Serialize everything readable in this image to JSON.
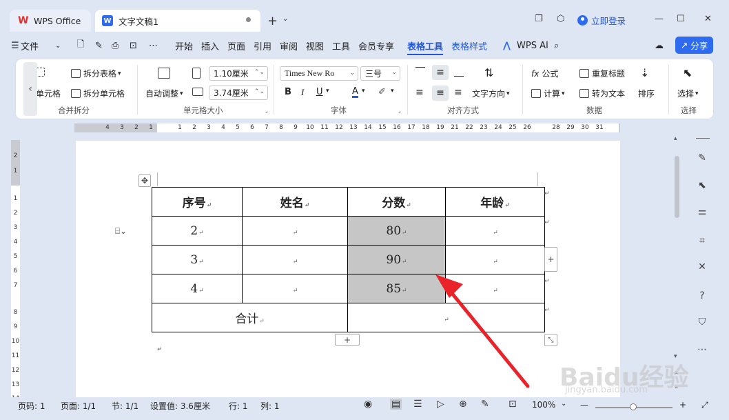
{
  "tabs": [
    {
      "label": "WPS Office"
    },
    {
      "label": "文字文稿1"
    }
  ],
  "header": {
    "login": "立即登录"
  },
  "menu": [
    "文件",
    "开始",
    "插入",
    "页面",
    "引用",
    "审阅",
    "视图",
    "工具",
    "会员专享",
    "表格工具",
    "表格样式",
    "WPS AI"
  ],
  "share": "分享",
  "ribbon": {
    "merge_cells": "单元格",
    "split_table": "拆分表格",
    "split_cells": "拆分单元格",
    "auto_adjust": "自动调整",
    "row_height": "1.10厘米",
    "col_width": "3.74厘米",
    "font_name": "Times New Ro",
    "font_size": "三号",
    "text_direction": "文字方向",
    "formula": "公式",
    "calculate": "计算",
    "repeat_title": "重复标题",
    "to_text": "转为文本",
    "sort": "排序",
    "select": "选择",
    "groups": {
      "merge_split": "合并拆分",
      "cell_size": "单元格大小",
      "font": "字体",
      "align": "对齐方式",
      "data": "数据",
      "select": "选择"
    }
  },
  "ruler": {
    "h": [
      "4",
      "3",
      "2",
      "1",
      "1",
      "2",
      "3",
      "4",
      "5",
      "6",
      "7",
      "8",
      "9",
      "10",
      "11",
      "12",
      "13",
      "14",
      "15",
      "16",
      "17",
      "18",
      "19",
      "21",
      "22",
      "23",
      "24",
      "25",
      "26",
      "28",
      "29",
      "30",
      "31"
    ],
    "v": [
      "2",
      "1",
      "1",
      "2",
      "3",
      "4",
      "5",
      "6",
      "7",
      "8",
      "9",
      "10",
      "11",
      "12",
      "13",
      "14"
    ]
  },
  "table": {
    "headers": [
      "序号",
      "姓名",
      "分数",
      "年龄"
    ],
    "rows": [
      [
        "2",
        "",
        "80",
        ""
      ],
      [
        "3",
        "",
        "90",
        ""
      ],
      [
        "4",
        "",
        "85",
        ""
      ]
    ],
    "total_label": "合计"
  },
  "status": {
    "page_no": "页码: 1",
    "page": "页面: 1/1",
    "section": "节: 1/1",
    "setting": "设置值: 3.6厘米",
    "row": "行: 1",
    "col": "列: 1",
    "zoom": "100%"
  },
  "watermark": {
    "main": "Baidu经验",
    "sub": "jingyan.baidu.com"
  },
  "colors": {
    "accent": "#2f6bef",
    "highlight": "#c6c6c6",
    "arrow": "#e8232a"
  }
}
